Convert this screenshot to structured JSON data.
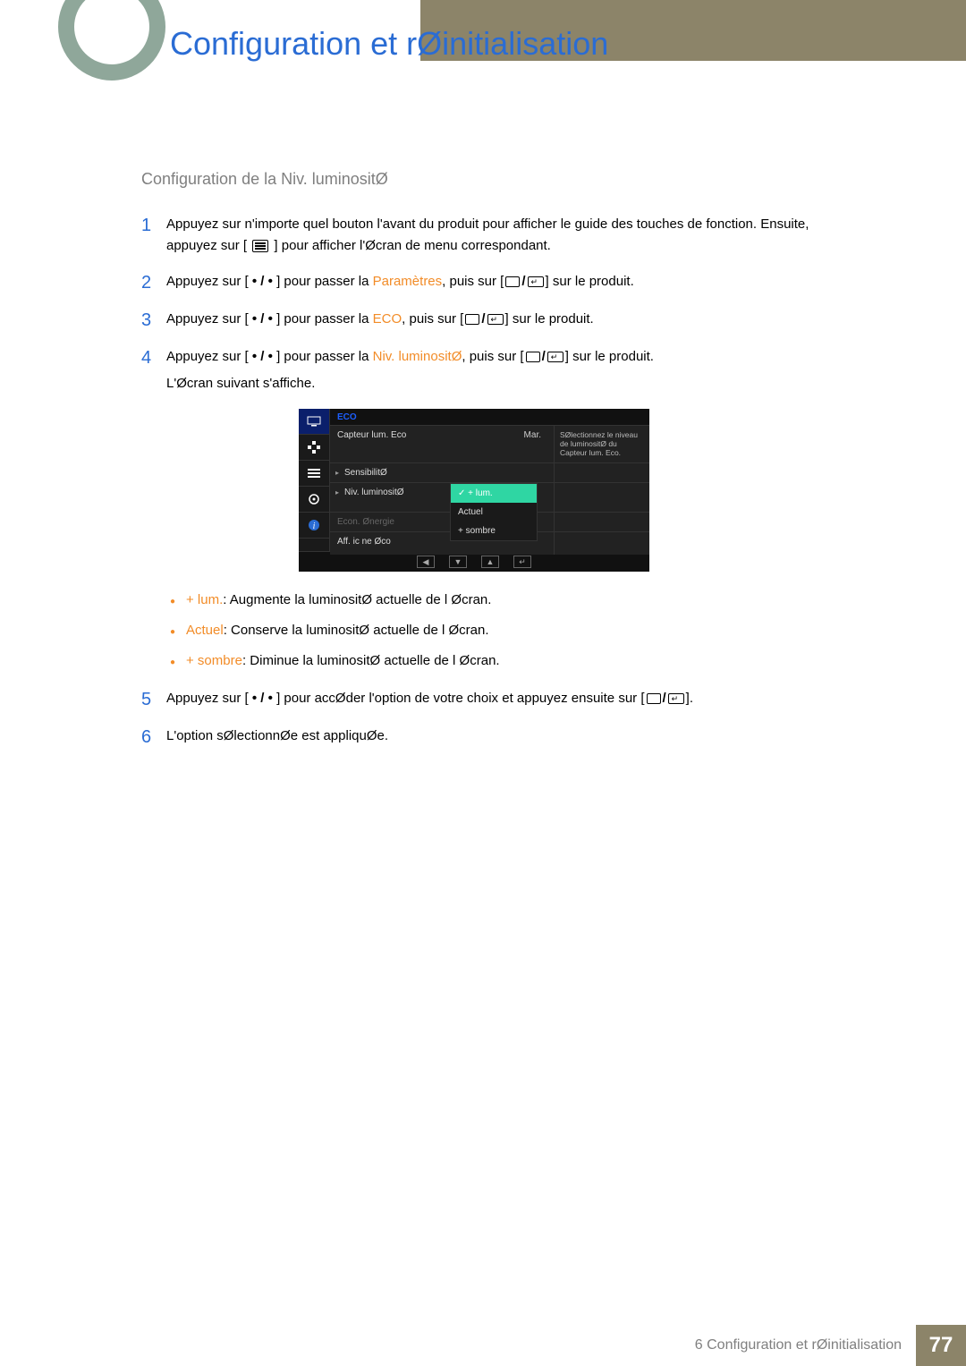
{
  "chapter_title": "Configuration et rØinitialisation",
  "section_heading": "Configuration de la Niv. luminositØ",
  "steps": {
    "s1": {
      "num": "1",
      "a": "Appuyez sur n'importe quel bouton   l'avant du produit pour afficher le guide des touches de fonction. Ensuite, appuyez sur [",
      "b": "] pour afficher l'Øcran de menu correspondant."
    },
    "s2": {
      "num": "2",
      "a": "Appuyez sur [",
      "b": "] pour passer   la ",
      "hl": "Paramètres",
      "c": ", puis sur [",
      "d": "] sur le produit."
    },
    "s3": {
      "num": "3",
      "a": "Appuyez sur [",
      "b": "] pour passer   la ",
      "hl": "ECO",
      "c": ", puis sur [",
      "d": "] sur le produit."
    },
    "s4": {
      "num": "4",
      "a": "Appuyez sur [",
      "b": "] pour passer   la ",
      "hl": "Niv. luminositØ",
      "c": ", puis sur [",
      "d": "] sur le produit.",
      "tail": "L'Øcran suivant s'affiche."
    },
    "s5": {
      "num": "5",
      "a": "Appuyez sur [",
      "b": "] pour accØder   l'option de votre choix et appuyez ensuite sur [",
      "c": "]."
    },
    "s6": {
      "num": "6",
      "a": "L'option sØlectionnØe est appliquØe."
    }
  },
  "nav_dots": " • / • ",
  "bullets": {
    "b1": {
      "hl": "+ lum.",
      "txt": ": Augmente la luminositØ actuelle de l Øcran."
    },
    "b2": {
      "hl": "Actuel",
      "txt": ": Conserve la luminositØ actuelle de l Øcran."
    },
    "b3": {
      "hl": "+ sombre",
      "txt": ": Diminue la luminositØ actuelle de l Øcran."
    }
  },
  "osd": {
    "header": "ECO",
    "help": "SØlectionnez le niveau de luminositØ du Capteur lum. Eco.",
    "row1": {
      "label": "Capteur lum. Eco",
      "value": "Mar."
    },
    "row2": {
      "label": "SensibilitØ"
    },
    "row3": {
      "label": "Niv. luminositØ"
    },
    "row4": {
      "label": "Econ. Ønergie"
    },
    "row5": {
      "label": "Aff. ic ne Øco"
    },
    "popup": {
      "opt1": "+ lum.",
      "opt2": "Actuel",
      "opt3": "+ sombre"
    },
    "nav": {
      "a": "◀",
      "b": "▼",
      "c": "▲",
      "d": "↵"
    }
  },
  "footer": {
    "label": "6 Configuration et rØinitialisation",
    "page": "77"
  }
}
